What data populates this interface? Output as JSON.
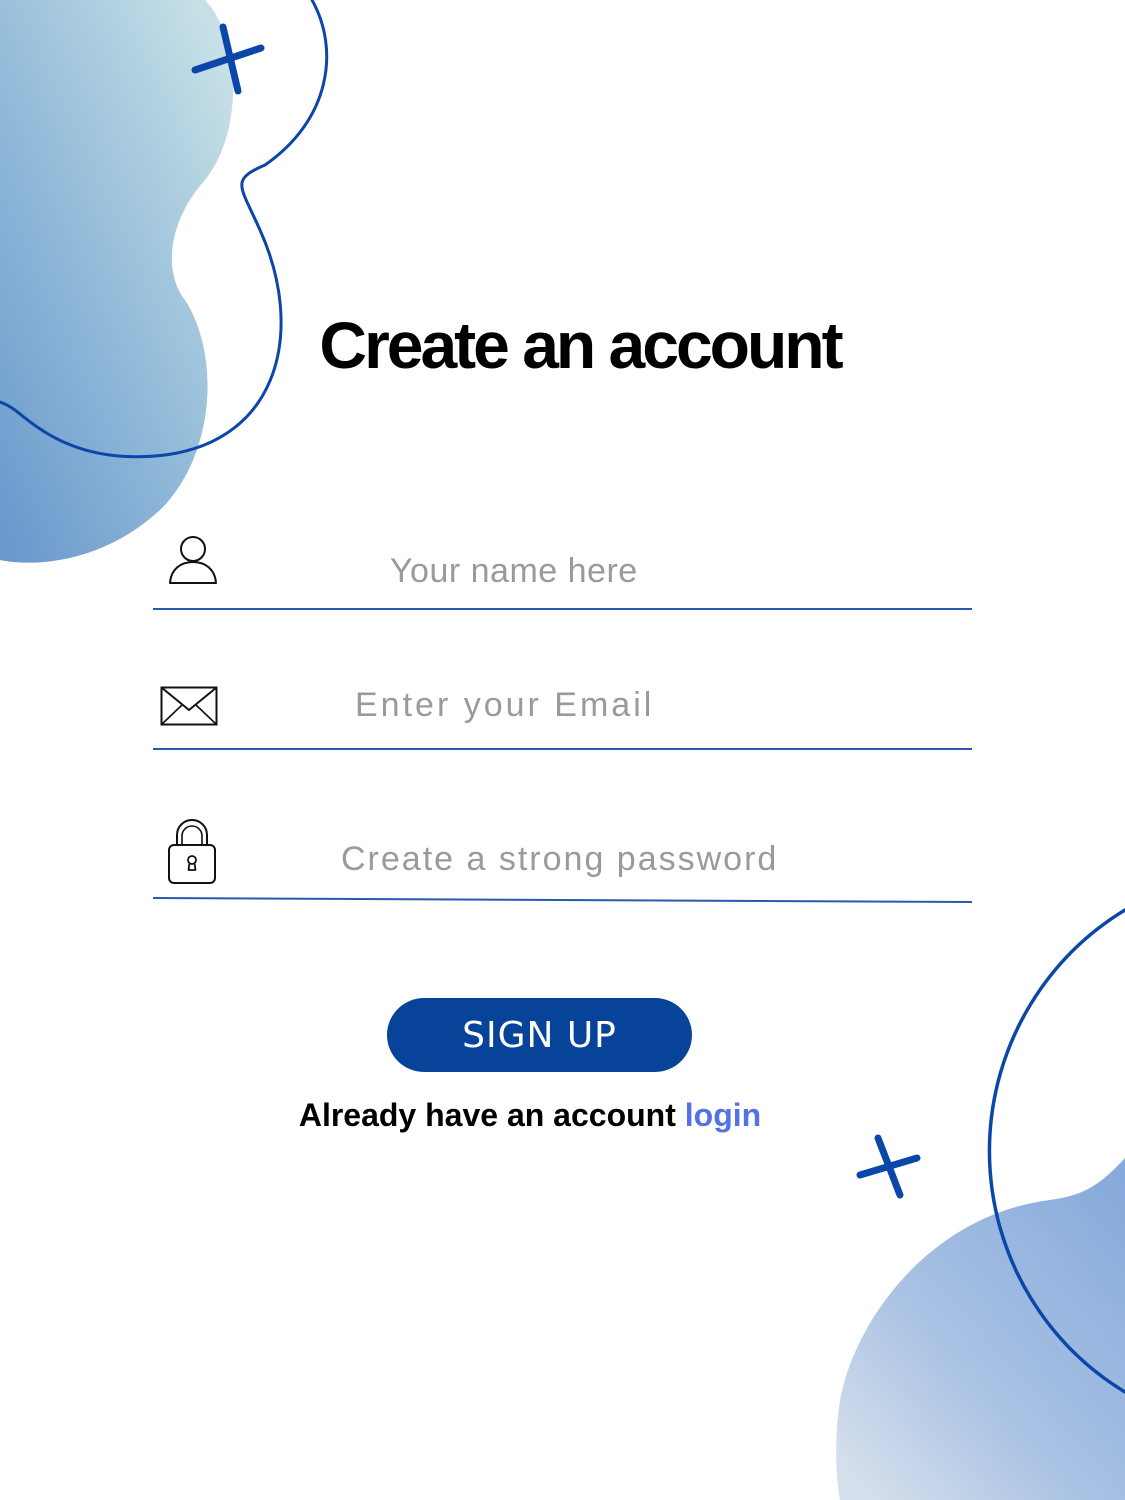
{
  "title": "Create an account",
  "fields": {
    "name": {
      "placeholder": "Your name here",
      "icon": "user-icon"
    },
    "email": {
      "placeholder": "Enter your Email",
      "icon": "envelope-icon"
    },
    "password": {
      "placeholder": "Create a strong password",
      "icon": "lock-icon"
    }
  },
  "signup_button": {
    "label": "SIGN UP"
  },
  "login_prompt": {
    "text": "Already have an account",
    "link_label": "login"
  },
  "decorations": {
    "icons": [
      "plus-icon",
      "plus-icon"
    ]
  },
  "colors": {
    "accent": "#074399",
    "underline": "#2a5ab0",
    "link": "#5272e6",
    "placeholder": "#9a9a9a",
    "blob_light": "#c6e0e6",
    "blob_dark": "#6a98cc"
  }
}
